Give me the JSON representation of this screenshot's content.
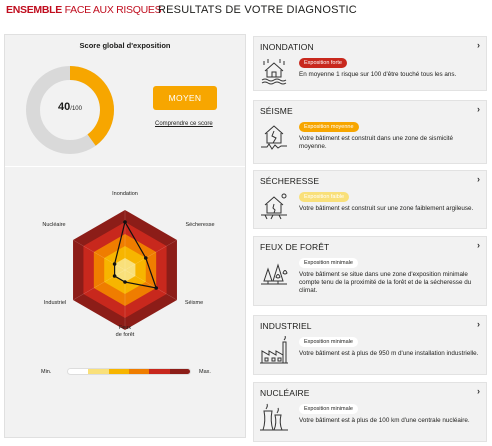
{
  "header": {
    "brand_bold": "ENSEMBLE",
    "brand_light": "FACE AUX RISQUES",
    "page_title": "RESULTATS DE VOTRE DIAGNOSTIC"
  },
  "score": {
    "title": "Score global d'exposition",
    "value": "40",
    "max": "/100",
    "fraction": 0.4,
    "level_label": "MOYEN",
    "link_label": "Comprendre ce score",
    "colors": {
      "filled": "#f7a600",
      "empty": "#d9d9d9"
    }
  },
  "radar": {
    "axes": [
      "Inondation",
      "Sécheresse",
      "Séisme",
      "Feux de forêt",
      "Industriel",
      "Nucléaire"
    ],
    "feux_line1": "Feux",
    "feux_line2": "de forêt",
    "levels": [
      4,
      2,
      3,
      1,
      1,
      1
    ],
    "max_level": 5,
    "ring_colors": [
      "#8c1d18",
      "#c8281d",
      "#ef7d00",
      "#f7b500",
      "#f9e07a"
    ]
  },
  "legend": {
    "min": "Min.",
    "max": "Max.",
    "colors": [
      "#ffffff",
      "#f9e07a",
      "#f7b500",
      "#ef7d00",
      "#c8281d",
      "#8c1d18"
    ]
  },
  "cards": [
    {
      "title": "INONDATION",
      "badge": "Exposition forte",
      "badge_bg": "#c8281d",
      "badge_fg": "#ffffff",
      "icon": "flood-house-icon",
      "desc": "En moyenne 1 risque sur 100 d'être touché tous les ans."
    },
    {
      "title": "SÉISME",
      "badge": "Exposition moyenne",
      "badge_bg": "#f7a600",
      "badge_fg": "#ffffff",
      "icon": "earthquake-house-icon",
      "desc": "Votre bâtiment est construit dans une zone de sismicité moyenne."
    },
    {
      "title": "SÉCHERESSE",
      "badge": "Exposition faible",
      "badge_bg": "#f9e07a",
      "badge_fg": "#ffffff",
      "icon": "drought-house-icon",
      "desc": "Votre bâtiment est construit sur une zone faiblement argileuse."
    },
    {
      "title": "FEUX DE FORÊT",
      "badge": "Exposition minimale",
      "badge_bg": "#ffffff",
      "badge_fg": "#1d1d1b",
      "icon": "forest-fire-icon",
      "desc": "Votre bâtiment se situe dans une zone d'exposition minimale compte tenu de la proximité de la forêt et de la sécheresse du climat."
    },
    {
      "title": "INDUSTRIEL",
      "badge": "Exposition minimale",
      "badge_bg": "#ffffff",
      "badge_fg": "#1d1d1b",
      "icon": "factory-icon",
      "desc": "Votre bâtiment est à plus de 950 m d'une installation industrielle."
    },
    {
      "title": "NUCLÉAIRE",
      "badge": "Exposition minimale",
      "badge_bg": "#ffffff",
      "badge_fg": "#1d1d1b",
      "icon": "nuclear-plant-icon",
      "desc": "Votre bâtiment est à plus de 100 km d'une centrale nucléaire."
    }
  ]
}
